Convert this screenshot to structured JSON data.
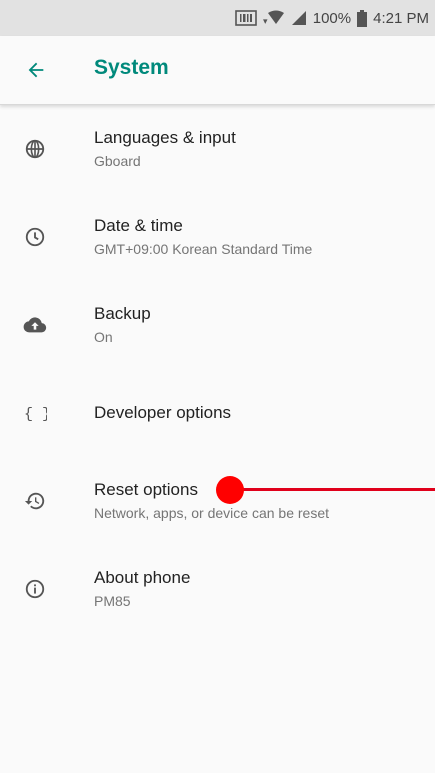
{
  "status_bar": {
    "battery": "100%",
    "time": "4:21 PM"
  },
  "header": {
    "title": "System"
  },
  "items": [
    {
      "title": "Languages & input",
      "summary": "Gboard",
      "icon": "globe-icon"
    },
    {
      "title": "Date & time",
      "summary": "GMT+09:00 Korean Standard Time",
      "icon": "clock-icon"
    },
    {
      "title": "Backup",
      "summary": "On",
      "icon": "cloud-upload-icon"
    },
    {
      "title": "Developer options",
      "summary": "",
      "icon": "braces-icon"
    },
    {
      "title": "Reset options",
      "summary": "Network, apps, or device can be reset",
      "icon": "restore-icon"
    },
    {
      "title": "About phone",
      "summary": "PM85",
      "icon": "info-icon"
    }
  ],
  "colors": {
    "accent": "#00897b",
    "touch_indicator": "#ff0000"
  }
}
